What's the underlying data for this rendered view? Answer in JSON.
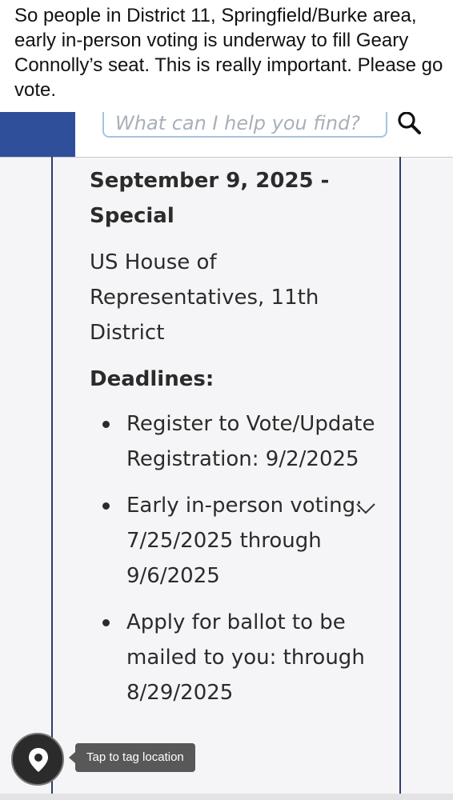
{
  "caption": "So people in District 11, Springfield/Burke area, early in-person voting is underway to fill Geary Connolly’s seat. This is really important.  Please go vote.",
  "search": {
    "placeholder": "What can I help you find?"
  },
  "election": {
    "title": "September 9, 2025 - Special",
    "office": "US House of Representatives, 11th District",
    "deadlines_heading": "Deadlines:",
    "deadlines": [
      "Register to Vote/Update Registration: 9/2/2025",
      "Early in-person voting: 7/25/2025 through 9/6/2025",
      "Apply for ballot to be mailed to you: through 8/29/2025"
    ]
  },
  "tag_location": {
    "label": "Tap to tag location"
  },
  "colors": {
    "header_blue": "#2f4f9b",
    "card_border": "#2c3e6e",
    "search_border": "#a7c3dd"
  },
  "icons": [
    "search-icon",
    "chevron-down-icon",
    "location-pin-icon"
  ]
}
